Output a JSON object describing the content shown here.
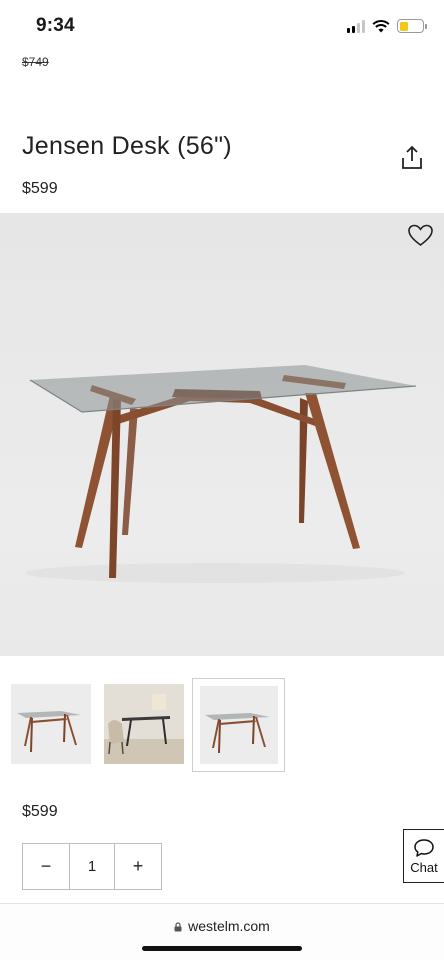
{
  "status_bar": {
    "time": "9:34"
  },
  "product": {
    "old_price": "$749",
    "title": "Jensen Desk (56\")",
    "price": "$599",
    "price_bottom": "$599"
  },
  "icons": {
    "share": "share-icon",
    "favorite": "heart-icon",
    "chat": "chat-bubble-icon",
    "lock": "lock-icon"
  },
  "thumbnails": [
    {
      "name": "desk-glass-top-view"
    },
    {
      "name": "desk-room-setting"
    },
    {
      "name": "desk-glass-top-view-selected"
    }
  ],
  "quantity": {
    "minus_label": "−",
    "value": "1",
    "plus_label": "+"
  },
  "chat": {
    "label": "Chat"
  },
  "browser": {
    "url": "westelm.com"
  },
  "colors": {
    "wood": "#8a4e30",
    "wood_dark": "#6e3b22",
    "glass": "#8c9294",
    "hero_bg": "#e8e8e8",
    "battery": "#f5c518"
  }
}
